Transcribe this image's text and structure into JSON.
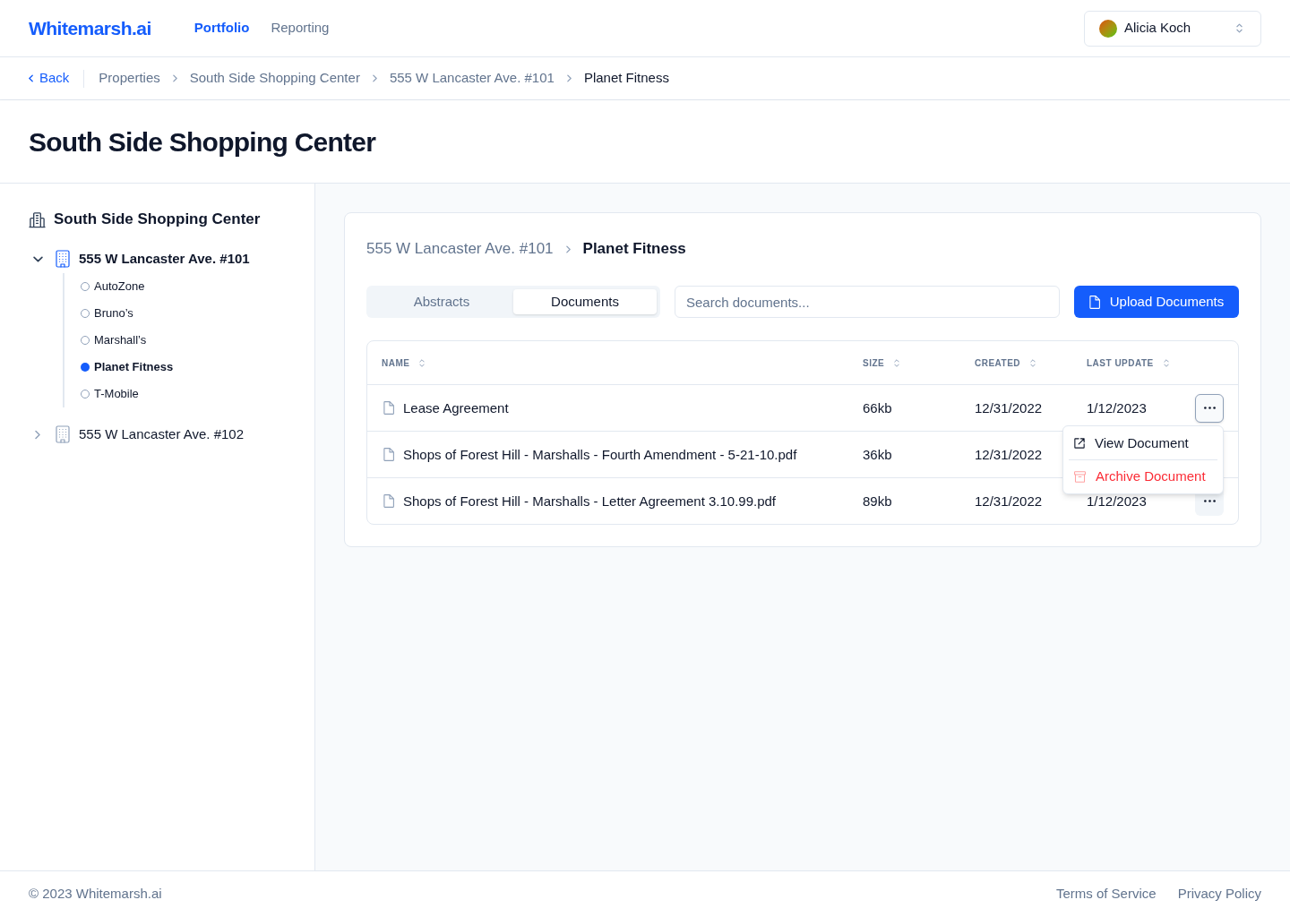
{
  "header": {
    "logo": "Whitemarsh.ai",
    "nav": [
      {
        "label": "Portfolio",
        "selected": true
      },
      {
        "label": "Reporting",
        "selected": false
      }
    ],
    "user": {
      "name": "Alicia Koch"
    }
  },
  "breadcrumb": {
    "back": "Back",
    "items": [
      "Properties",
      "South Side Shopping Center",
      "555 W Lancaster Ave. #101",
      "Planet Fitness"
    ]
  },
  "page_title": "South Side Shopping Center",
  "sidebar": {
    "title": "South Side Shopping Center",
    "units": [
      {
        "label": "555 W Lancaster Ave. #101",
        "expanded": true,
        "selected": true,
        "children": [
          {
            "label": "AutoZone",
            "selected": false
          },
          {
            "label": "Bruno’s",
            "selected": false
          },
          {
            "label": "Marshall’s",
            "selected": false
          },
          {
            "label": "Planet Fitness",
            "selected": true
          },
          {
            "label": "T-Mobile",
            "selected": false
          }
        ]
      },
      {
        "label": "555 W Lancaster Ave. #102",
        "expanded": false,
        "selected": false
      }
    ]
  },
  "panel": {
    "breadcrumb": [
      "555 W Lancaster Ave. #101",
      "Planet Fitness"
    ],
    "tabs": [
      {
        "label": "Abstracts",
        "selected": false
      },
      {
        "label": "Documents",
        "selected": true
      }
    ],
    "search": {
      "placeholder": "Search documents..."
    },
    "upload_button": "Upload Documents",
    "table": {
      "columns": [
        "NAME",
        "SIZE",
        "CREATED",
        "LAST UPDATE"
      ],
      "rows": [
        {
          "cells": [
            "Lease Agreement",
            "66kb",
            "12/31/2022",
            "1/12/2023"
          ],
          "menu_open": true,
          "hovered": false
        },
        {
          "cells": [
            "Shops of Forest Hill - Marshalls - Fourth Amendment - 5-21-10.pdf",
            "36kb",
            "12/31/2022"
          ],
          "menu_open": false,
          "hovered": false
        },
        {
          "cells": [
            "Shops of Forest Hill - Marshalls - Letter Agreement 3.10.99.pdf",
            "89kb",
            "12/31/2022",
            "1/12/2023"
          ],
          "menu_open": false,
          "hovered": true
        }
      ],
      "menu": [
        {
          "label": "View Document",
          "kind": "view"
        },
        {
          "label": "Archive Document",
          "kind": "archive"
        }
      ]
    }
  },
  "footer": {
    "copyright": "© 2023 Whitemarsh.ai",
    "links": [
      "Terms of Service",
      "Privacy Policy"
    ]
  }
}
